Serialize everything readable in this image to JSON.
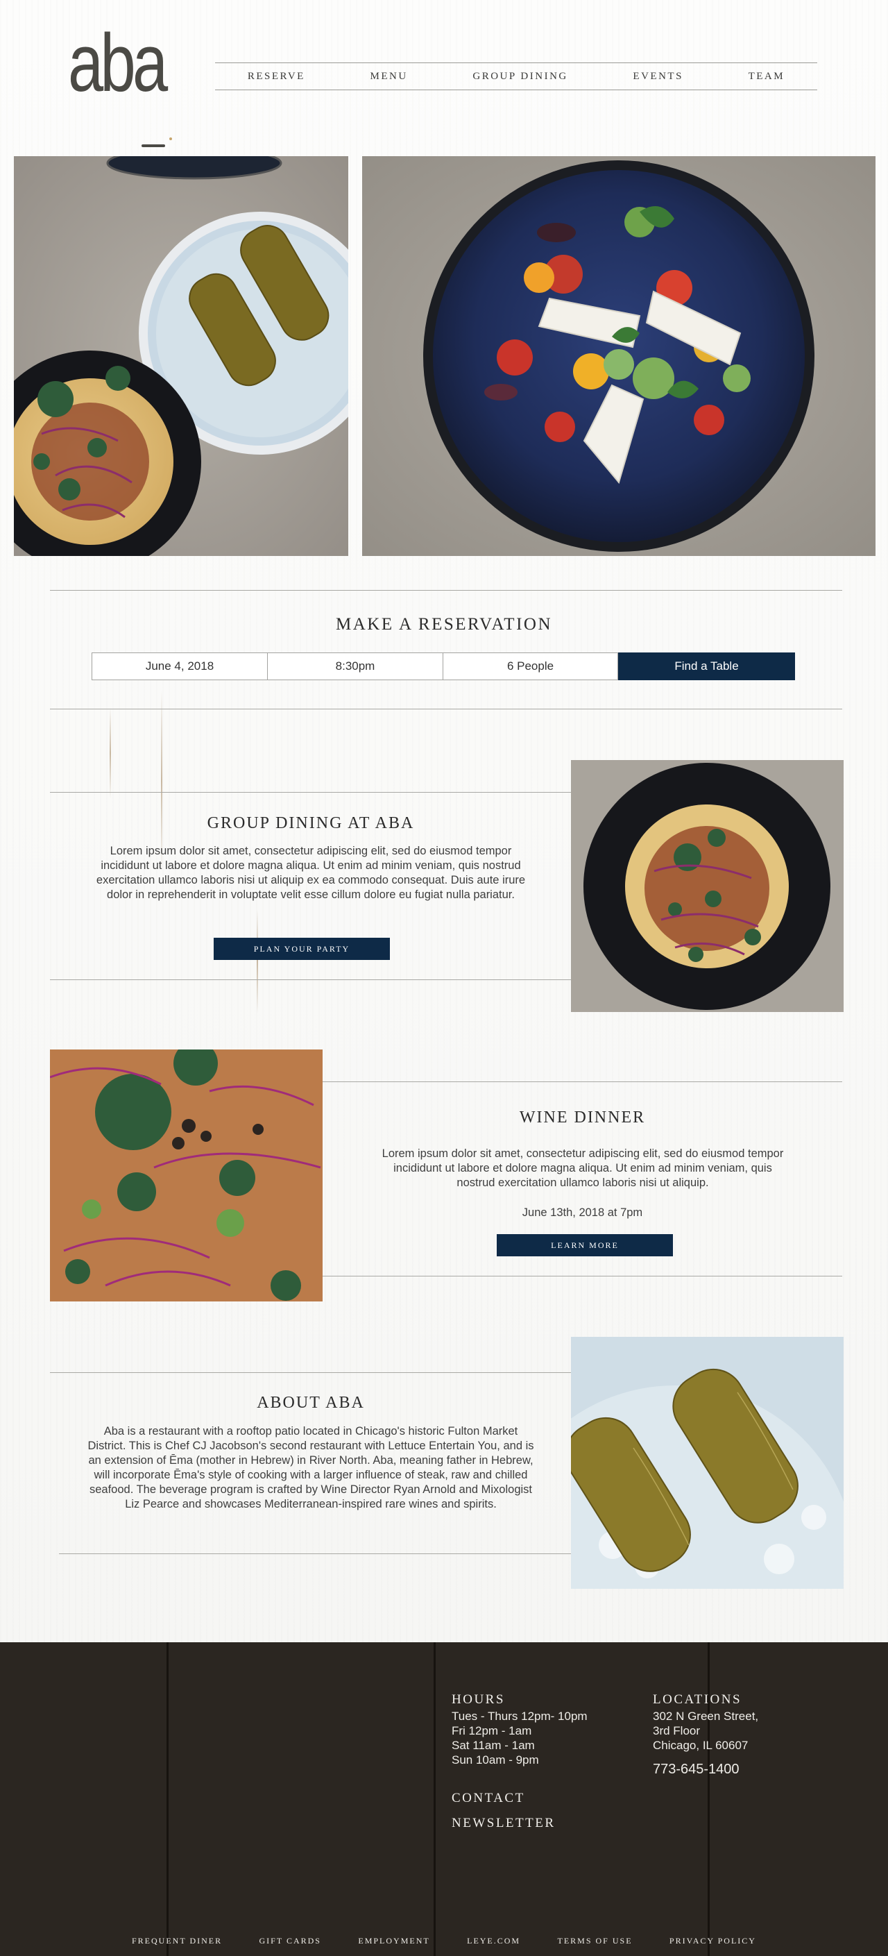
{
  "brand": {
    "logo_text": "aba"
  },
  "nav": {
    "items": [
      {
        "label": "RESERVE"
      },
      {
        "label": "MENU"
      },
      {
        "label": "GROUP DINING"
      },
      {
        "label": "EVENTS"
      },
      {
        "label": "TEAM"
      }
    ]
  },
  "reservation": {
    "title": "MAKE A RESERVATION",
    "date": "June 4, 2018",
    "time": "8:30pm",
    "party": "6 People",
    "button": "Find a Table"
  },
  "group_dining": {
    "title": "GROUP DINING AT ABA",
    "body": "Lorem ipsum dolor sit amet, consectetur adipiscing elit, sed do eiusmod tempor incididunt ut labore et dolore magna aliqua. Ut enim ad minim veniam, quis nostrud exercitation ullamco laboris nisi ut aliquip ex ea commodo consequat. Duis aute irure dolor in reprehenderit in voluptate velit esse cillum dolore eu fugiat nulla pariatur.",
    "button": "PLAN YOUR PARTY"
  },
  "wine_dinner": {
    "title": "WINE DINNER",
    "body": "Lorem ipsum dolor sit amet, consectetur adipiscing elit, sed do eiusmod tempor incididunt ut labore et dolore magna aliqua. Ut enim ad minim veniam, quis nostrud exercitation ullamco laboris nisi ut aliquip.",
    "date": "June 13th, 2018 at 7pm",
    "button": "LEARN MORE"
  },
  "about": {
    "title": "ABOUT ABA",
    "body": "Aba is a restaurant with a rooftop patio located in Chicago's historic Fulton Market District. This is Chef CJ Jacobson's second restaurant with Lettuce Entertain You, and is an extension of Ēma (mother in Hebrew) in River North. Aba, meaning father in Hebrew, will incorporate Ēma's style of cooking with a larger influence of steak, raw and chilled seafood. The beverage program is crafted by Wine Director Ryan Arnold and Mixologist Liz Pearce and showcases Mediterranean-inspired rare wines and spirits."
  },
  "footer": {
    "hours_heading": "HOURS",
    "hours": [
      "Tues - Thurs 12pm- 10pm",
      "Fri 12pm - 1am",
      "Sat 11am - 1am",
      "Sun 10am - 9pm"
    ],
    "locations_heading": "LOCATIONS",
    "address": [
      "302 N Green Street,",
      "3rd Floor",
      "Chicago, IL 60607"
    ],
    "phone": "773-645-1400",
    "contact": "CONTACT",
    "newsletter": "NEWSLETTER",
    "links": [
      "FREQUENT DINER",
      "GIFT CARDS",
      "EMPLOYMENT",
      "LEYE.COM",
      "TERMS OF USE",
      "PRIVACY POLICY"
    ]
  },
  "colors": {
    "accent": "#0e2a47",
    "footer_bg": "#2b2621",
    "text": "#3a3a3a"
  }
}
